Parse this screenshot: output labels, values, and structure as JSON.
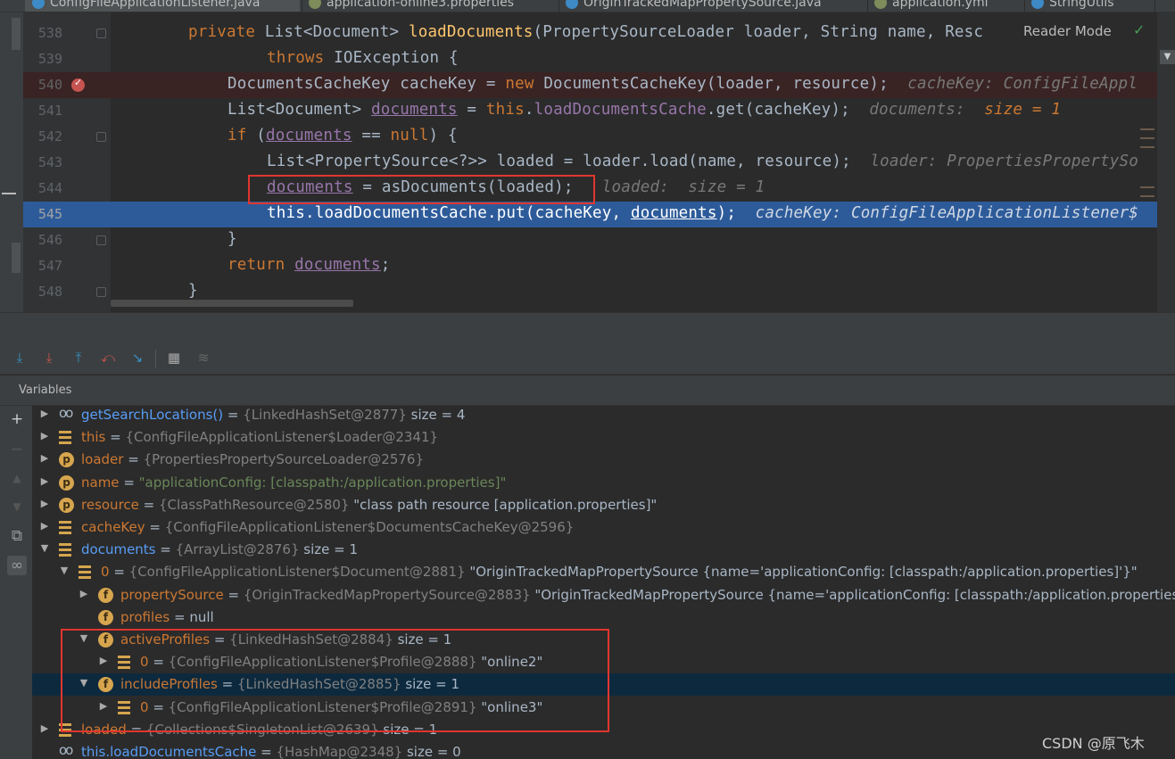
{
  "tabs": [
    {
      "label": "ConfigFileApplicationListener.java",
      "active": true
    },
    {
      "label": "application-online3.properties",
      "active": false
    },
    {
      "label": "OriginTrackedMapPropertySource.java",
      "active": false
    },
    {
      "label": "application.yml",
      "active": false
    },
    {
      "label": "StringUtils",
      "active": false
    }
  ],
  "editor": {
    "reader_mode": "Reader Mode",
    "lines": [
      {
        "num": "538",
        "state": "normal"
      },
      {
        "num": "539",
        "state": "normal"
      },
      {
        "num": "540",
        "state": "breakpoint"
      },
      {
        "num": "541",
        "state": "normal"
      },
      {
        "num": "542",
        "state": "normal"
      },
      {
        "num": "543",
        "state": "normal"
      },
      {
        "num": "544",
        "state": "normal"
      },
      {
        "num": "545",
        "state": "current"
      },
      {
        "num": "546",
        "state": "normal"
      },
      {
        "num": "547",
        "state": "normal"
      },
      {
        "num": "548",
        "state": "normal"
      }
    ],
    "code": {
      "l538": {
        "kw": "private",
        "type": "List<Document>",
        "fn": "loadDocuments",
        "rest": "(PropertySourceLoader loader, String name, Resc"
      },
      "l539": {
        "kw": "throws",
        "rest": "IOException {"
      },
      "l540": {
        "a": "DocumentsCacheKey cacheKey = ",
        "kw": "new",
        "b": "DocumentsCacheKey(loader, resource);",
        "hint": "cacheKey: ConfigFileAppl"
      },
      "l541": {
        "a": "List<Document> ",
        "var": "documents",
        "b": " = ",
        "kw": "this",
        "field": "loadDocumentsCache",
        "c": ".get(cacheKey);",
        "hint": "documents:  ",
        "hintval": "size = 1"
      },
      "l542": {
        "kw": "if",
        "a": " (",
        "var": "documents",
        "b": " == ",
        "kw2": "null",
        "c": ") {"
      },
      "l543": {
        "a": "List<PropertySource<?>> loaded = loader.load(name, resource);",
        "hint": "loader: PropertiesPropertySo"
      },
      "l544": {
        "var": "documents",
        "a": " = asDocuments(loaded);",
        "hint": "loaded:  size = 1"
      },
      "l545": {
        "kw": "this",
        "field": "loadDocumentsCache",
        "a": ".put(cacheKey, ",
        "var": "documents",
        "b": ");",
        "hint": "cacheKey: ConfigFileApplicationListener$"
      },
      "l546": {
        "a": "}"
      },
      "l547": {
        "kw": "return",
        "var": "documents",
        "a": ";"
      },
      "l548": {
        "a": "}"
      }
    }
  },
  "debug": {
    "panel_title": "Variables",
    "toolbar_icons": [
      "step-over-icon",
      "step-into-icon",
      "step-out-icon",
      "run-to-cursor-icon",
      "force-step-icon",
      "evaluate-icon",
      "trace-icon"
    ],
    "variables": [
      {
        "indent": 0,
        "expand": "▶",
        "icon": "w",
        "name": "getSearchLocations()",
        "name_style": "watch",
        "type": "{LinkedHashSet@2877}",
        "value": " size = 4",
        "value_style": "val"
      },
      {
        "indent": 0,
        "expand": "▶",
        "icon": "l",
        "name": "this",
        "name_style": "red",
        "type": "{ConfigFileApplicationListener$Loader@2341}",
        "value": "",
        "value_style": "val"
      },
      {
        "indent": 0,
        "expand": "▶",
        "icon": "p",
        "name": "loader",
        "name_style": "red",
        "type": "{PropertiesPropertySourceLoader@2576}",
        "value": "",
        "value_style": "val"
      },
      {
        "indent": 0,
        "expand": "▶",
        "icon": "p",
        "name": "name",
        "name_style": "red",
        "type": "",
        "value": "\"applicationConfig: [classpath:/application.properties]\"",
        "value_style": "str"
      },
      {
        "indent": 0,
        "expand": "▶",
        "icon": "p",
        "name": "resource",
        "name_style": "red",
        "type": "{ClassPathResource@2580}",
        "value": " \"class path resource [application.properties]\"",
        "value_style": "val"
      },
      {
        "indent": 0,
        "expand": "▶",
        "icon": "l",
        "name": "cacheKey",
        "name_style": "red",
        "type": "{ConfigFileApplicationListener$DocumentsCacheKey@2596}",
        "value": "",
        "value_style": "val"
      },
      {
        "indent": 0,
        "expand": "▼",
        "icon": "l",
        "name": "documents",
        "name_style": "watch",
        "type": "{ArrayList@2876}",
        "value": "  size = 1",
        "value_style": "val"
      },
      {
        "indent": 1,
        "expand": "▼",
        "icon": "l",
        "name": "0",
        "name_style": "red",
        "type": "{ConfigFileApplicationListener$Document@2881}",
        "value": " \"OriginTrackedMapPropertySource {name='applicationConfig: [classpath:/application.properties]'}\"",
        "value_style": "val"
      },
      {
        "indent": 2,
        "expand": "▶",
        "icon": "f",
        "name": "propertySource",
        "name_style": "red",
        "type": "{OriginTrackedMapPropertySource@2883}",
        "value": " \"OriginTrackedMapPropertySource {name='applicationConfig: [classpath:/application.properties]'}\"",
        "value_style": "val"
      },
      {
        "indent": 2,
        "expand": "",
        "icon": "f",
        "name": "profiles",
        "name_style": "red",
        "type": "",
        "value": "null",
        "value_style": "val"
      },
      {
        "indent": 2,
        "expand": "▼",
        "icon": "f",
        "name": "activeProfiles",
        "name_style": "red",
        "type": "{LinkedHashSet@2884}",
        "value": "  size = 1",
        "value_style": "val"
      },
      {
        "indent": 3,
        "expand": "▶",
        "icon": "l",
        "name": "0",
        "name_style": "red",
        "type": "{ConfigFileApplicationListener$Profile@2888}",
        "value": " \"online2\"",
        "value_style": "val"
      },
      {
        "indent": 2,
        "expand": "▼",
        "icon": "f",
        "name": "includeProfiles",
        "name_style": "red",
        "type": "{LinkedHashSet@2885}",
        "value": "  size = 1",
        "value_style": "val",
        "selected": true
      },
      {
        "indent": 3,
        "expand": "▶",
        "icon": "l",
        "name": "0",
        "name_style": "red",
        "type": "{ConfigFileApplicationListener$Profile@2891}",
        "value": " \"online3\"",
        "value_style": "val"
      },
      {
        "indent": 0,
        "expand": "▶",
        "icon": "l",
        "name": "loaded",
        "name_style": "red",
        "type": "{Collections$SingletonList@2639}",
        "value": "  size = 1",
        "value_style": "val"
      },
      {
        "indent": 0,
        "expand": "",
        "icon": "w",
        "name": "this.loadDocumentsCache",
        "name_style": "watch",
        "type": "{HashMap@2348}",
        "value": "  size = 0",
        "value_style": "val"
      }
    ]
  },
  "watermark": "CSDN @原飞木"
}
